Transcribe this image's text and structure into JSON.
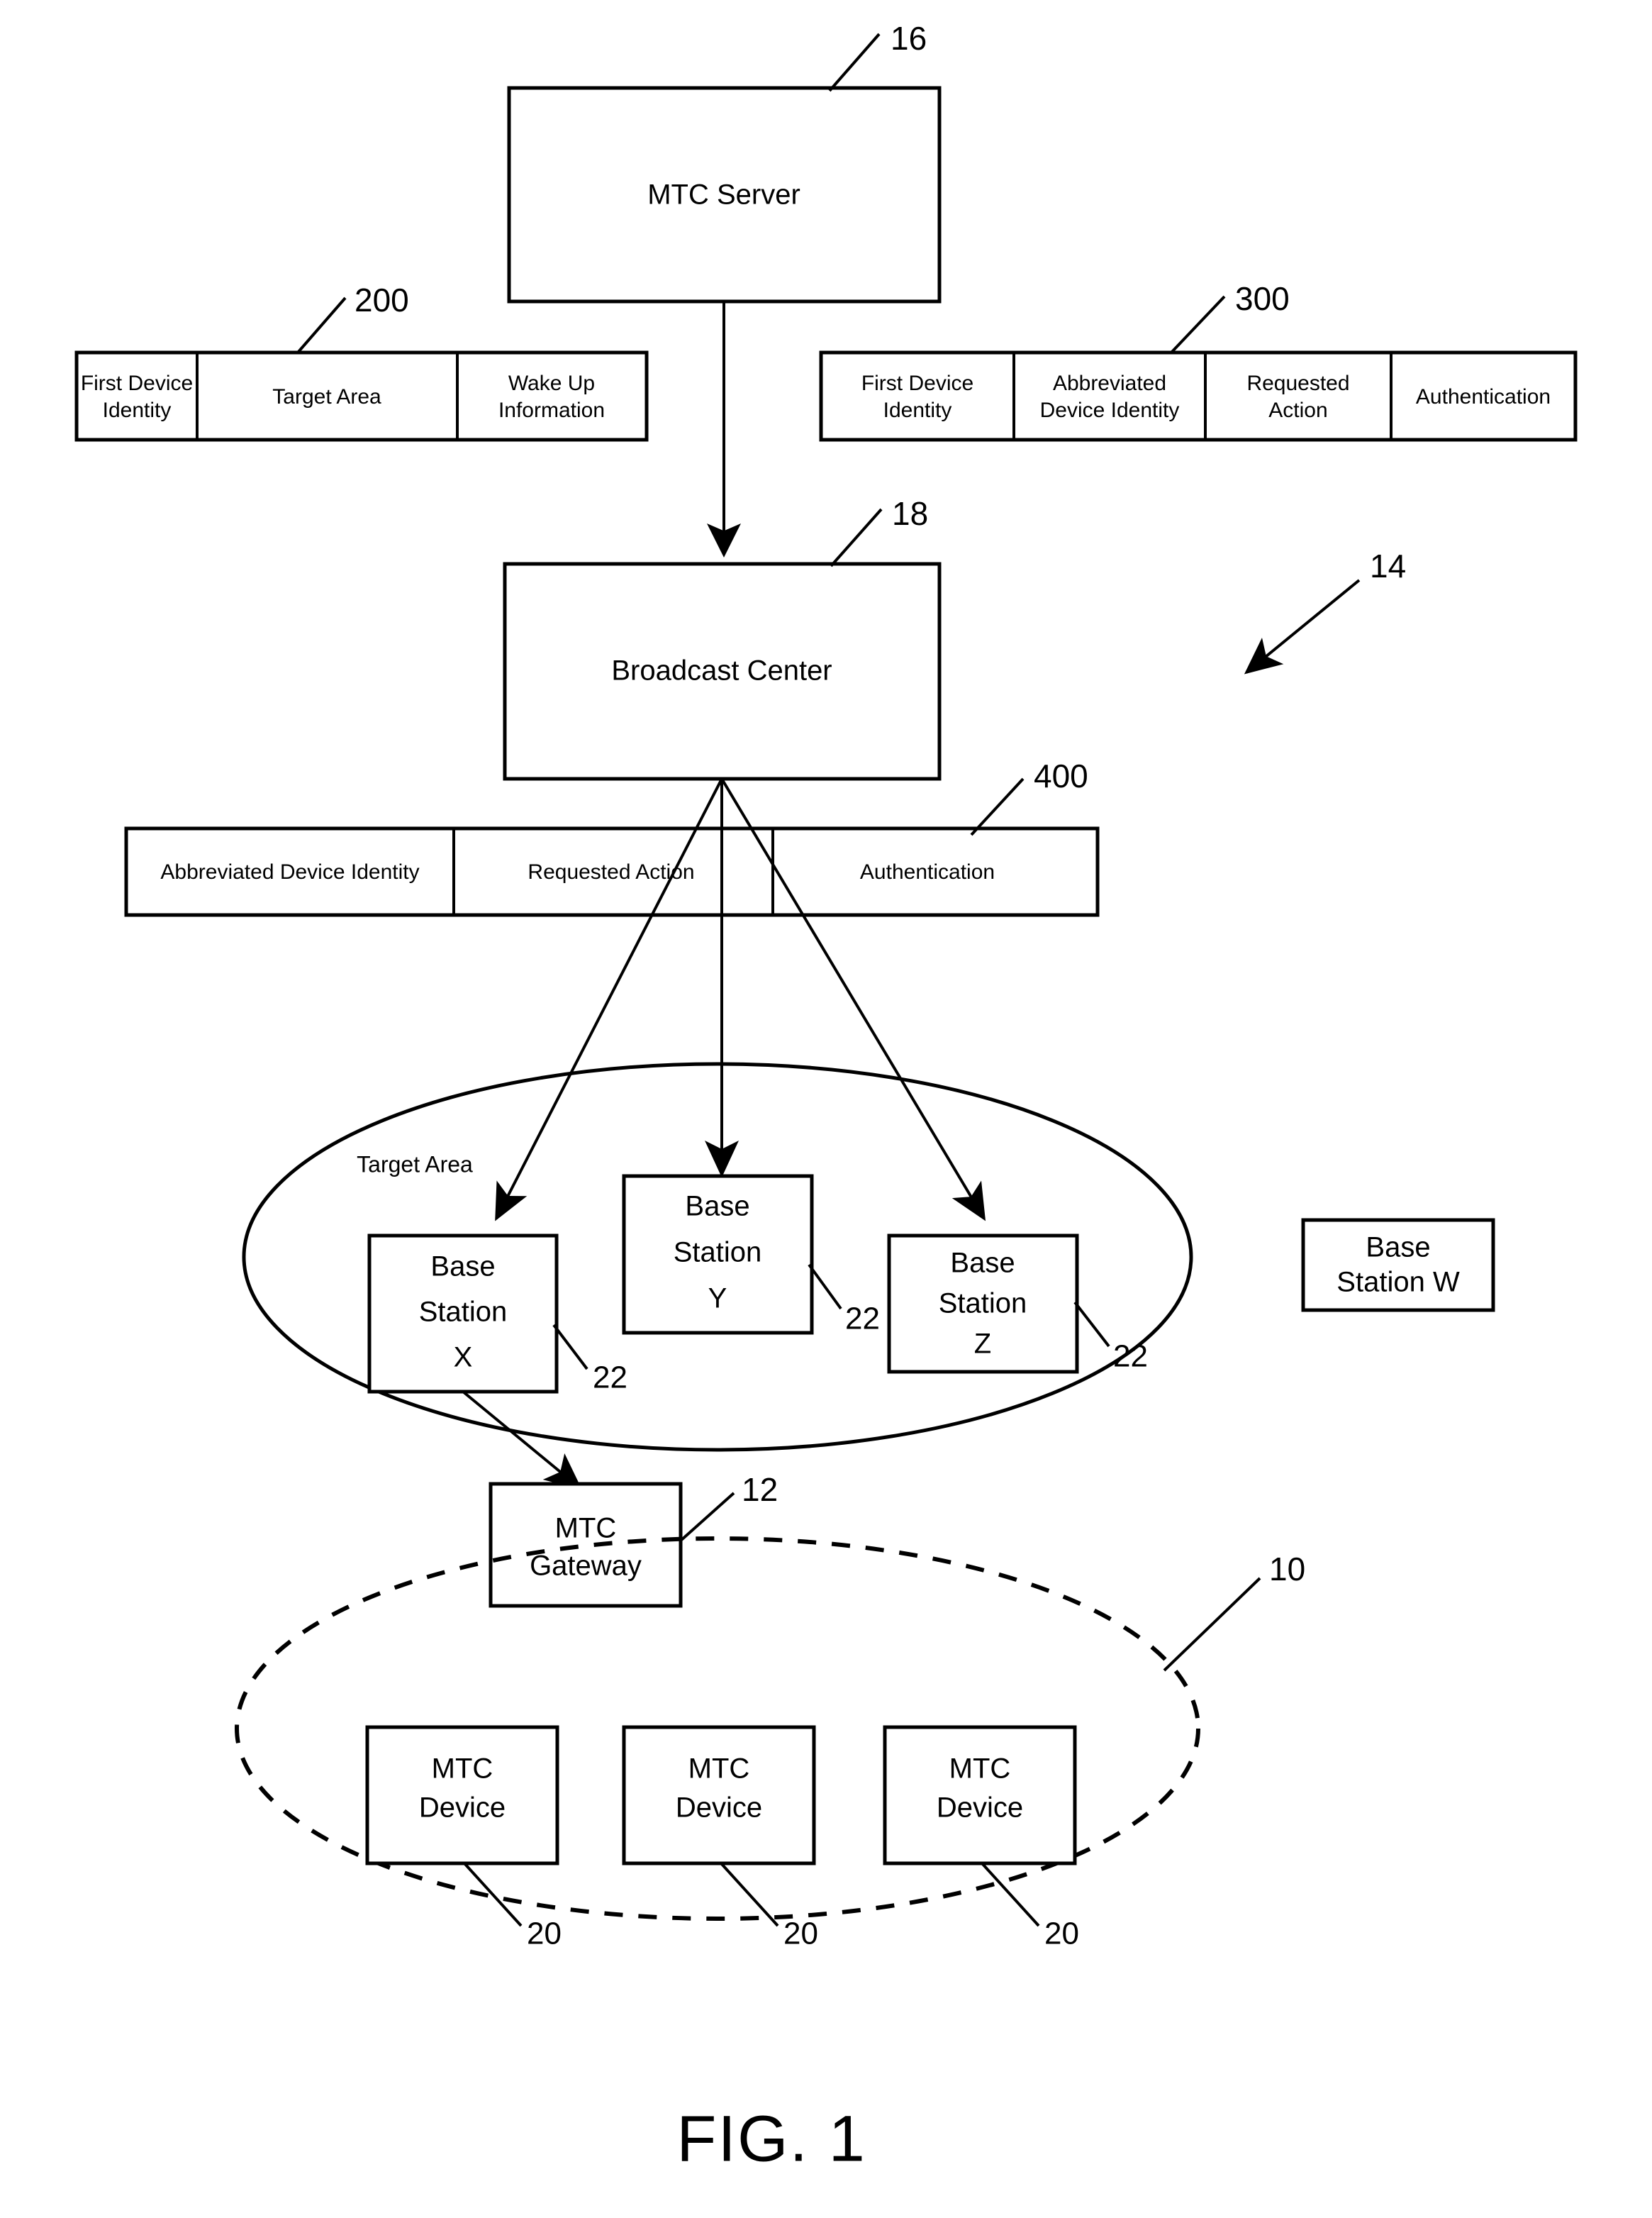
{
  "figure": {
    "caption": "FIG. 1"
  },
  "nodes": {
    "mtc_server": {
      "label": "MTC Server",
      "ref": "16"
    },
    "broadcast_center": {
      "label": "Broadcast Center",
      "ref": "18"
    },
    "base_station_x": {
      "line1": "Base",
      "line2": "Station",
      "line3": "X",
      "ref": "22"
    },
    "base_station_y": {
      "line1": "Base",
      "line2": "Station",
      "line3": "Y",
      "ref": "22"
    },
    "base_station_z": {
      "line1": "Base",
      "line2": "Station",
      "line3": "Z",
      "ref": "22"
    },
    "base_station_w": {
      "line1": "Base",
      "line2": "Station W"
    },
    "mtc_gateway": {
      "line1": "MTC",
      "line2": "Gateway",
      "ref": "12"
    },
    "mtc_device_1": {
      "line1": "MTC",
      "line2": "Device",
      "ref": "20"
    },
    "mtc_device_2": {
      "line1": "MTC",
      "line2": "Device",
      "ref": "20"
    },
    "mtc_device_3": {
      "line1": "MTC",
      "line2": "Device",
      "ref": "20"
    }
  },
  "regions": {
    "target_area": {
      "label": "Target Area",
      "ref": "14"
    },
    "device_group": {
      "ref": "10"
    }
  },
  "messages": {
    "msg_200": {
      "ref": "200",
      "fields": [
        {
          "line1": "First Device",
          "line2": "Identity"
        },
        {
          "line1": "Target Area",
          "line2": ""
        },
        {
          "line1": "Wake Up",
          "line2": "Information"
        }
      ]
    },
    "msg_300": {
      "ref": "300",
      "fields": [
        {
          "line1": "First Device",
          "line2": "Identity"
        },
        {
          "line1": "Abbreviated",
          "line2": "Device Identity"
        },
        {
          "line1": "Requested",
          "line2": "Action"
        },
        {
          "line1": "Authentication",
          "line2": ""
        }
      ]
    },
    "msg_400": {
      "ref": "400",
      "fields": [
        {
          "line1": "Abbreviated Device Identity",
          "line2": ""
        },
        {
          "line1": "Requested Action",
          "line2": ""
        },
        {
          "line1": "Authentication",
          "line2": ""
        }
      ]
    }
  },
  "colors": {
    "ink": "#000000",
    "paper": "#ffffff"
  }
}
